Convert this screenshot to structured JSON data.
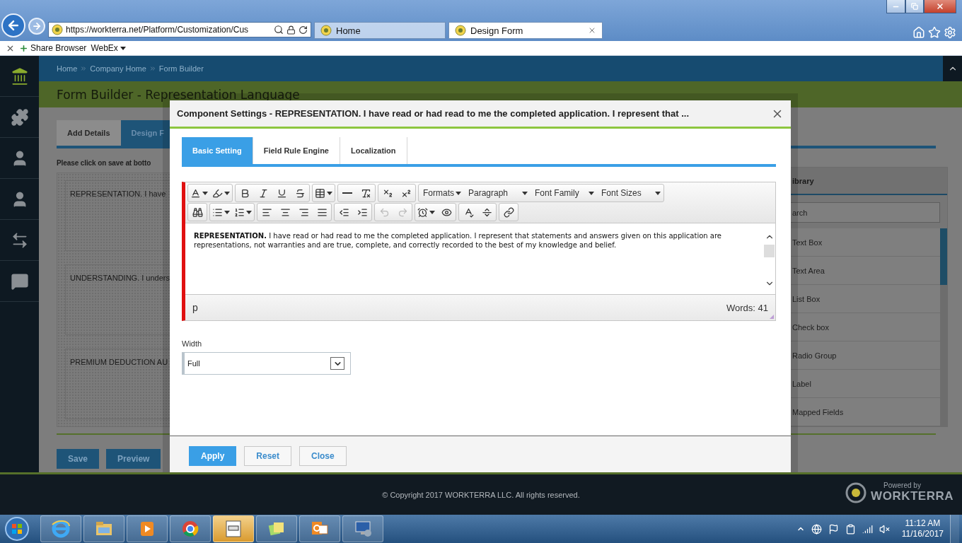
{
  "browser": {
    "address": "https://workterra.net/Platform/Customization/Cus",
    "tabs": [
      {
        "title": "Home",
        "selected": false
      },
      {
        "title": "Design Form",
        "selected": true
      }
    ],
    "favorites": [
      {
        "label": "Share Browser",
        "kind": "link"
      },
      {
        "label": "WebEx",
        "kind": "menu"
      }
    ]
  },
  "app": {
    "sidebar": [
      {
        "selected": true
      },
      {
        "selected": false
      },
      {
        "selected": false
      },
      {
        "selected": false
      },
      {
        "selected": false
      },
      {
        "selected": false
      }
    ],
    "breadcrumbs": [
      "Home",
      "Company Home",
      "Form Builder"
    ],
    "title": "Form Builder - Representation Language",
    "page_tabs": [
      {
        "label": "Add Details",
        "selected": false
      },
      {
        "label": "Design F",
        "selected": true
      }
    ],
    "notice": "Please click on save at botto",
    "form_components": [
      "REPRESENTATION. I have",
      "UNDERSTANDING. I unders",
      "PREMIUM DEDUCTION AU"
    ],
    "page_buttons": [
      "Save",
      "Preview"
    ],
    "library": {
      "title": "ibrary",
      "search_placeholder": "arch",
      "items": [
        "Text Box",
        "Text Area",
        "List Box",
        "Check box",
        "Radio Group",
        "Label",
        "Mapped Fields"
      ]
    }
  },
  "dialog": {
    "title": "Component Settings - REPRESENTATION. I have read or had read to me the completed application. I represent that ...",
    "tabs": [
      {
        "label": "Basic Setting",
        "selected": true
      },
      {
        "label": "Field Rule Engine",
        "selected": false
      },
      {
        "label": "Localization",
        "selected": false
      }
    ],
    "editor": {
      "dropdowns": [
        "Formats",
        "Paragraph",
        "Font Family",
        "Font Sizes"
      ],
      "undo_enabled": false,
      "redo_enabled": false,
      "content": "**REPRESENTATION.** I have read or had read to me the completed application. I represent that statements and answers given on this application are representations, not warranties and are true, complete, and correctly recorded to the best of my knowledge and belief.",
      "path": "p",
      "word_count": "Words: 41"
    },
    "width_label": "Width",
    "width_value": "Full",
    "buttons": [
      {
        "label": "Apply",
        "kind": "primary"
      },
      {
        "label": "Reset",
        "kind": "secondary"
      },
      {
        "label": "Close",
        "kind": "secondary"
      }
    ]
  },
  "footer": {
    "copyright": "© Copyright 2017 WORKTERRA LLC. All rights reserved.",
    "powered_by": "Powered by",
    "brand": "WORKTERRA"
  },
  "taskbar": {
    "time": "11:12 AM",
    "date": "11/16/2017"
  }
}
